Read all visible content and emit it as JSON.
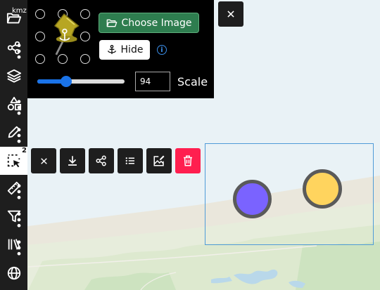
{
  "toolbar": {
    "file_badge": "kmz",
    "selection_count": "2"
  },
  "pin_panel": {
    "choose_image_label": "Choose Image",
    "hide_label": "Hide",
    "info_glyph": "i",
    "scale_value": "94",
    "scale_label": "Scale",
    "slider_fraction": 0.33
  },
  "markers": [
    {
      "color": "#7a63ff"
    },
    {
      "color": "#ffd45e"
    }
  ],
  "colors": {
    "delete_button": "#ff1f4f",
    "choose_button": "#2e7d4f",
    "accent": "#1a73e8"
  }
}
